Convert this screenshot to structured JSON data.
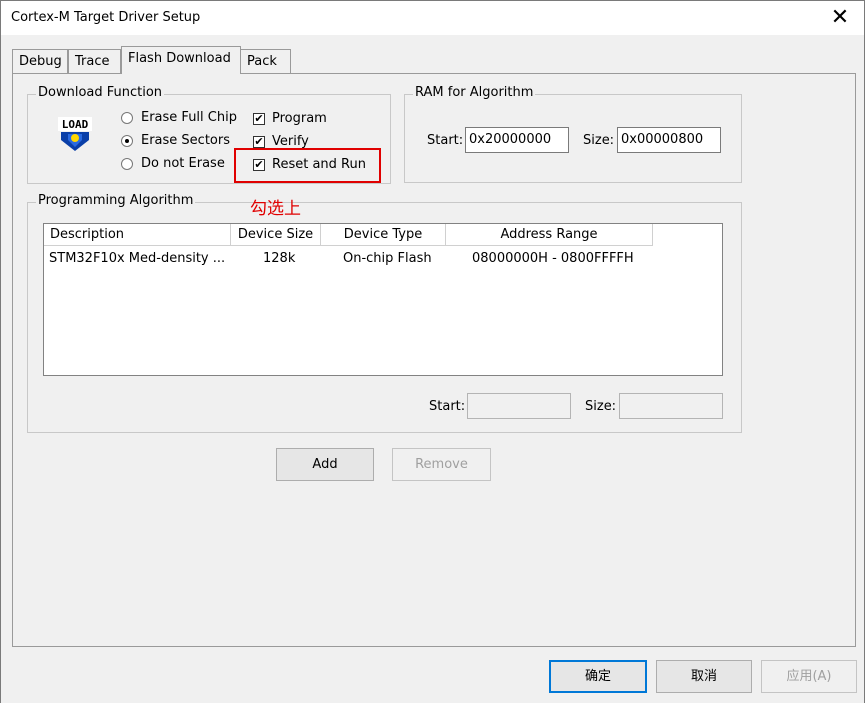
{
  "window": {
    "title": "Cortex-M Target Driver Setup",
    "close_glyph": "✕"
  },
  "tabs": [
    {
      "label": "Debug"
    },
    {
      "label": "Trace"
    },
    {
      "label": "Flash Download"
    },
    {
      "label": "Pack"
    }
  ],
  "download_function": {
    "title": "Download Function",
    "icon": "load-icon",
    "icon_text": "LOAD",
    "erase_options": [
      {
        "label": "Erase Full Chip",
        "selected": false
      },
      {
        "label": "Erase Sectors",
        "selected": true
      },
      {
        "label": "Do not Erase",
        "selected": false
      }
    ],
    "checks": [
      {
        "label": "Program",
        "checked": true
      },
      {
        "label": "Verify",
        "checked": true
      },
      {
        "label": "Reset and Run",
        "checked": true
      }
    ],
    "check_glyph": "✔"
  },
  "ram": {
    "title": "RAM for Algorithm",
    "start_label": "Start:",
    "start_value": "0x20000000",
    "size_label": "Size:",
    "size_value": "0x00000800"
  },
  "programming_algorithm": {
    "title": "Programming Algorithm",
    "columns": [
      "Description",
      "Device Size",
      "Device Type",
      "Address Range"
    ],
    "rows": [
      [
        "STM32F10x Med-density ...",
        "128k",
        "On-chip Flash",
        "08000000H - 0800FFFFH"
      ]
    ],
    "start_label": "Start:",
    "start_value": "",
    "size_label": "Size:",
    "size_value": ""
  },
  "buttons": {
    "add": "Add",
    "remove": "Remove"
  },
  "footer": {
    "ok": "确定",
    "cancel": "取消",
    "apply": "应用(A)"
  },
  "annotation": {
    "text": "勾选上",
    "color": "#e00000"
  }
}
